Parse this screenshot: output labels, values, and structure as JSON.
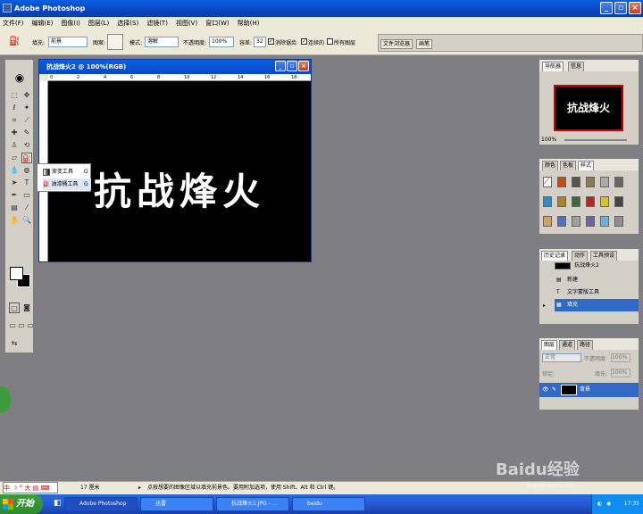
{
  "app": {
    "title": "Adobe Photoshop"
  },
  "menu": [
    "文件(F)",
    "编辑(E)",
    "图像(I)",
    "图层(L)",
    "选择(S)",
    "滤镜(T)",
    "视图(V)",
    "窗口(W)",
    "帮助(H)"
  ],
  "options": {
    "fill_label": "填充:",
    "fill_value": "前景",
    "pattern_label": "图案:",
    "mode_label": "模式:",
    "mode_value": "溶解",
    "opacity_label": "不透明度:",
    "opacity_value": "100%",
    "tolerance_label": "容差:",
    "tolerance_value": "32",
    "antialias": "消除锯齿",
    "contiguous": "连续的",
    "all_layers": "所有图层",
    "tab_file_browser": "文件浏览器",
    "tab_brushes": "画笔"
  },
  "document": {
    "title": "抗战烽火2 @ 100%(RGB)",
    "canvas_text": "抗战烽火",
    "ruler": [
      "0",
      "2",
      "4",
      "6",
      "8",
      "10",
      "12",
      "14",
      "16",
      "18"
    ]
  },
  "flyout": {
    "item1": "渐变工具",
    "item1_key": "G",
    "item2": "油漆桶工具",
    "item2_key": "G"
  },
  "navigator": {
    "tab1": "导航器",
    "tab2": "信息",
    "thumb_text": "抗战烽火",
    "zoom": "100%"
  },
  "swatches": {
    "tab1": "颜色",
    "tab2": "色板",
    "tab3": "样式"
  },
  "history": {
    "tab1": "历史记录",
    "tab2": "动作",
    "tab3": "工具预设",
    "snapshot": "抗战烽火2",
    "rows": [
      "新建",
      "文字蒙版工具",
      "填充"
    ]
  },
  "layers": {
    "tab1": "图层",
    "tab2": "通道",
    "tab3": "路径",
    "mode": "正常",
    "opacity_label": "不透明度:",
    "opacity_value": "100%",
    "lock_label": "锁定:",
    "fill_label": "填充:",
    "fill_value": "100%",
    "layer_name": "背景"
  },
  "status": {
    "size": "17 厘米",
    "message": "点按想要的图像区域以填充前景色。要用附加选项，使用 Shift、Alt 和 Ctrl 键。"
  },
  "ime": "中",
  "taskbar": {
    "start": "开始",
    "items": [
      "Adobe Photoshop",
      "迅雷",
      "抗战烽火1.JPG - ...",
      "baidu"
    ],
    "clock": "17:35"
  },
  "watermark": {
    "text": "Baidu经验",
    "url": "jingyan.baidu.com"
  }
}
